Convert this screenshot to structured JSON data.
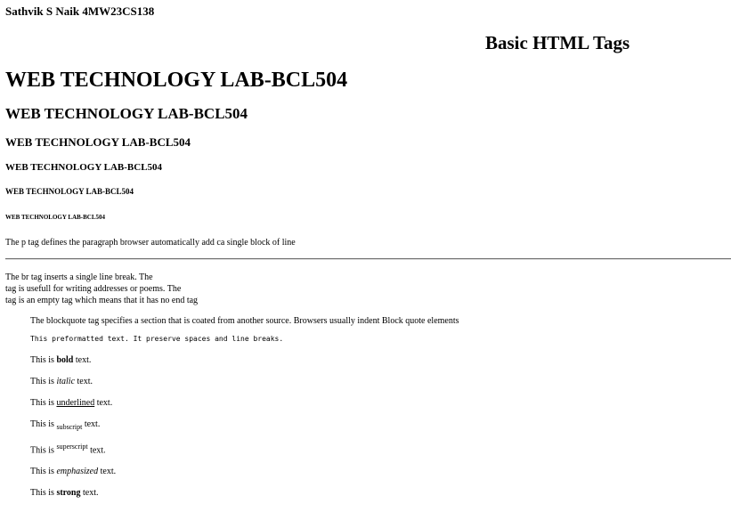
{
  "author": "Sathvik S Naik 4MW23CS138",
  "title": "Basic HTML Tags",
  "headings": {
    "h1": "WEB TECHNOLOGY LAB-BCL504",
    "h2": "WEB TECHNOLOGY LAB-BCL504",
    "h3": "WEB TECHNOLOGY LAB-BCL504",
    "h4": "WEB TECHNOLOGY LAB-BCL504",
    "h5": "WEB TECHNOLOGY LAB-BCL504",
    "h6": "WEB TECHNOLOGY LAB-BCL504"
  },
  "paragraph": "The p tag defines the paragraph browser automatically add ca single block of line",
  "br_lines": [
    "The br tag inserts a single line break. The",
    "tag is usefull for writing addresses or poems. The",
    "tag is an empty tag which means that it has no end tag"
  ],
  "blockquote": "The blockquote tag specifies a section that is coated from another source. Browsers usually indent Block quote elements",
  "preformatted": "This preformatted text. It preserve spaces and line breaks.",
  "formatting": {
    "prefix": "This is",
    "suffix": "text.",
    "bold": "bold",
    "italic": "italic",
    "underlined": "underlined",
    "subscript": "subscript",
    "superscript": "superscript",
    "emphasized": "emphasized",
    "strong": "strong"
  }
}
